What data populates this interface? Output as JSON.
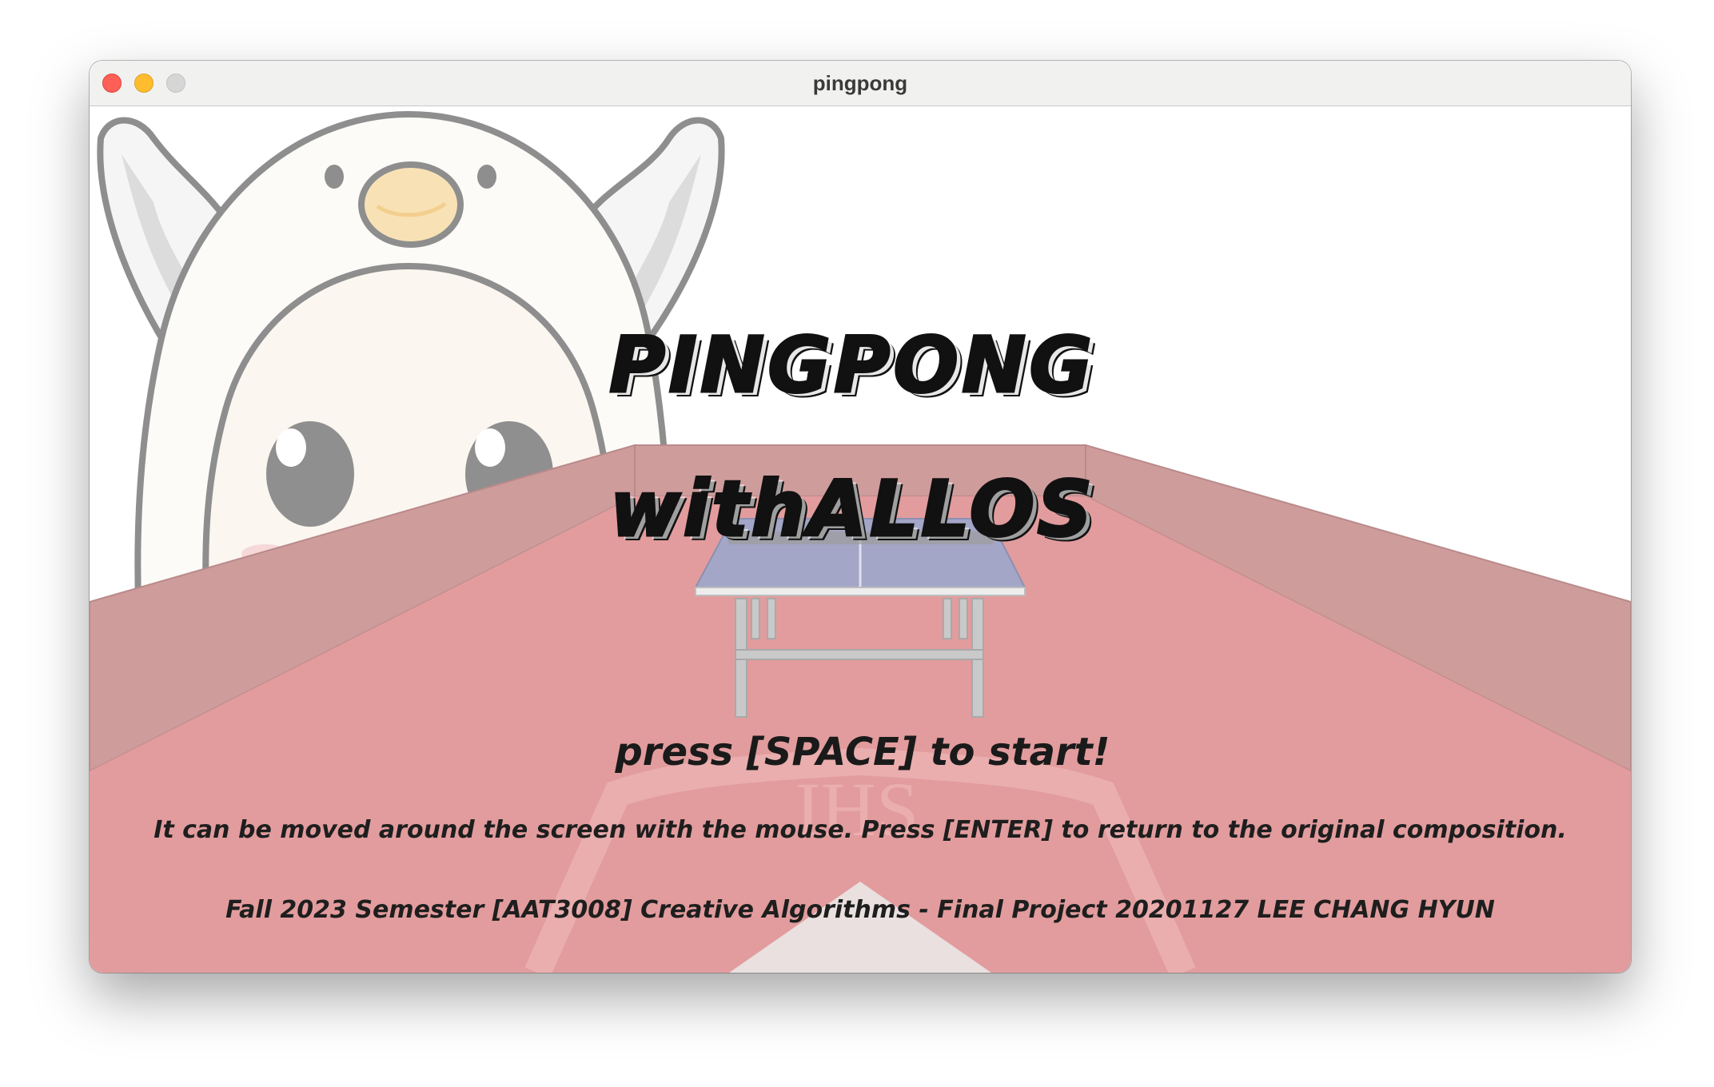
{
  "window": {
    "title": "pingpong",
    "controls": {
      "close": "close-button",
      "minimize": "minimize-button",
      "zoom": "zoom-button"
    }
  },
  "game": {
    "title_line_1": "PINGPONG",
    "title_line_2": "withALLOS",
    "prompt": "press [SPACE] to start!",
    "hint": "It can be moved around the screen with the mouse. Press [ENTER] to return to the original composition.",
    "credit": "Fall 2023 Semester [AAT3008] Creative Algorithms - Final Project 20201127 LEE CHANG HYUN",
    "floor_logo_text": "IHS"
  },
  "colors": {
    "floor": "#e29c9d",
    "walls": "#cf9c9c",
    "table_top": "#a3a6c6",
    "table_frame": "#c9c9c9",
    "mascot_outline": "#8e8e8e",
    "mascot_body": "#fcfbf8",
    "mascot_beak": "#f8e2b5"
  },
  "icons": {
    "mascot": "allos-mascot-icon",
    "table": "pingpong-table-icon",
    "floor_logo": "ihs-shield-logo"
  }
}
